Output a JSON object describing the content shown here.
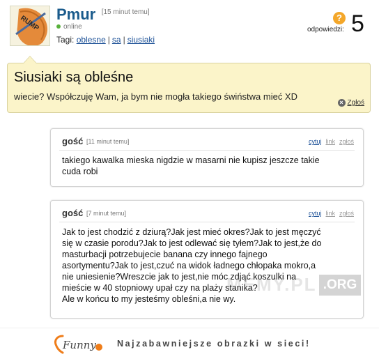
{
  "post": {
    "author": "Pmur",
    "time": "[15 minut temu]",
    "status": "online",
    "tags_label": "Tagi:",
    "tags": [
      "oblesne",
      "sa",
      "siusiaki"
    ],
    "answers_label": "odpowiedzi:",
    "answers_count": "5",
    "avatar_text": "RUMP"
  },
  "question": {
    "title": "Siusiaki są obleśne",
    "body": "wiecie? Współczuję Wam, ja bym nie mogła takiego świństwa mieć XD",
    "report": "Zgłoś"
  },
  "comments": [
    {
      "user": "gość",
      "time": "[11 minut temu]",
      "actions": [
        "cytuj",
        "link",
        "zgłoś"
      ],
      "text": "takiego kawalka mieska nigdzie w masarni nie kupisz jeszcze takie\ncuda robi"
    },
    {
      "user": "gość",
      "time": "[7 minut temu]",
      "actions": [
        "cytuj",
        "link",
        "zgłoś"
      ],
      "text": "Jak to jest chodzić z dziurą?Jak jest mieć okres?Jak to jest męczyć\nsię w czasie porodu?Jak to jest odlewać się tyłem?Jak to jest,że do\nmasturbacji potrzebujecie banana czy innego fajnego\nasortymentu?Jak to jest,czuć na widok ładnego chłopaka mokro,a\nnie uniesienie?Wreszcie jak to jest,nie móc zdjąć koszulki na\nmieście w 40 stopniowy upał czy na plaży stanika?\nAle w końcu to my jesteśmy obleśni,a nie wy."
    }
  ],
  "watermark": {
    "text": "MEMY.PL",
    "org": ".ORG"
  },
  "footer": {
    "logo": "Funny",
    "tagline": "Najzabawniejsze obrazki w sieci!"
  }
}
